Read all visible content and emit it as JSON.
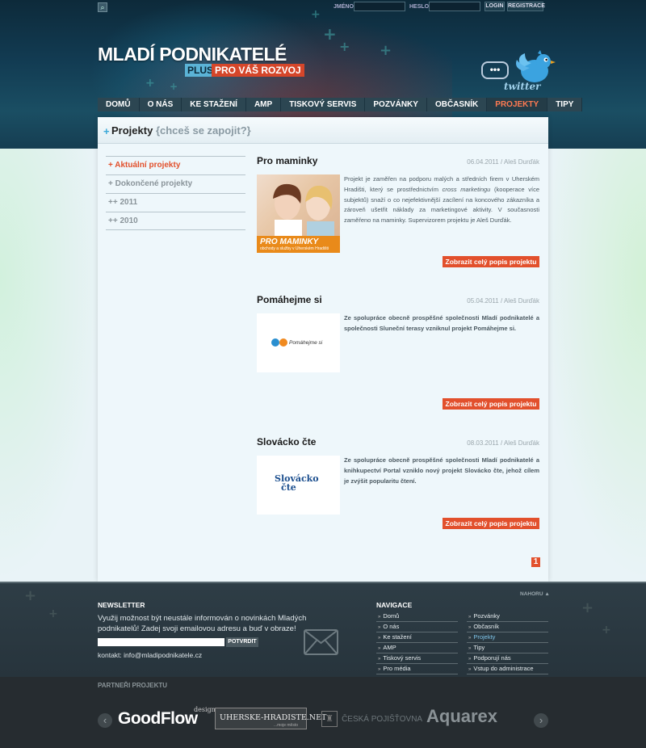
{
  "topbar": {
    "name_label": "JMÉNO",
    "password_label": "HESLO",
    "login_button": "LOGIN",
    "register_button": "REGISTRACE"
  },
  "logo": {
    "title": "MLADÍ PODNIKATELÉ",
    "plus": "PLUS",
    "tagline": "PRO VÁŠ ROZVOJ"
  },
  "twitter": {
    "bubble": "•••",
    "label": "twitter"
  },
  "nav": {
    "items": [
      "DOMŮ",
      "O NÁS",
      "KE STAŽENÍ",
      "AMP",
      "TISKOVÝ SERVIS",
      "POZVÁNKY",
      "OBČASNÍK",
      "PROJEKTY",
      "TIPY"
    ],
    "active": "PROJEKTY"
  },
  "page": {
    "title": "Projekty",
    "subtitle": "{chceš se zapojit?}"
  },
  "sidenav": {
    "items": [
      "+ Aktuální projekty",
      "+ Dokončené projekty",
      "++ 2011",
      "++ 2010"
    ],
    "active_index": 0
  },
  "projects": [
    {
      "title": "Pro maminky",
      "meta": "06.04.2011 / Aleš Durďák",
      "text_before": "Projekt je zaměřen na podporu malých a středních firem v Uherském Hradišti, který se prostřednictvím ",
      "text_italic": "cross marketingu",
      "text_after": " (kooperace více subjektů) snaží o co nejefektivnější zacílení na koncového zákazníka a zároveň ušetřit náklady za marketingové aktivity. V současnosti zaměřeno na maminky. Supervizorem projektu je Aleš Durďák.",
      "image_title": "PRO MAMINKY",
      "image_subtitle": "obchody a služby v Uherském Hradišti",
      "button": "Zobrazit celý popis projektu"
    },
    {
      "title": "Pomáhejme si",
      "meta": "05.04.2011 / Aleš Durďák",
      "text": "Ze spolupráce obecně prospěšné společnosti Mladí podnikatelé a společnosti Sluneční terasy vzniknul projekt Pomáhejme si.",
      "image_logo": "Pomáhejme si",
      "button": "Zobrazit celý popis projektu"
    },
    {
      "title": "Slovácko čte",
      "meta": "08.03.2011 / Aleš Durďák",
      "text": "Ze spolupráce obecně prospěšné společnosti Mladí podnikatelé a knihkupectví Portal vzniklo nový projekt Slovácko čte, jehož cílem je zvýšit popularitu čtení.",
      "image_logo_line1": "Slovácko",
      "image_logo_line2": "čte",
      "button": "Zobrazit celý popis projektu"
    }
  ],
  "pager": {
    "current": "1"
  },
  "footer": {
    "nahoru": "NAHORU",
    "newsletter": {
      "heading": "NEWSLETTER",
      "text": "Využij možnost být neustále informován o novinkách Mladých podnikatelů! Zadej svoji emailovou adresu a buď v obraze!",
      "button": "POTVRDIT",
      "contact": "kontakt: info@mladipodnikatele.cz"
    },
    "navigation": {
      "heading": "NAVIGACE",
      "col1": [
        "Domů",
        "O nás",
        "Ke stažení",
        "AMP",
        "Tiskový servis",
        "Pro média"
      ],
      "col2": [
        "Pozvánky",
        "Občasník",
        "Projekty",
        "Tipy",
        "Podporují nás",
        "Vstup do administrace"
      ],
      "active": "Projekty"
    }
  },
  "partners": {
    "title": "PARTNEŘI PROJEKTU",
    "items": [
      "GoodFlow",
      "design",
      "UHERSKE-HRADISTE.NET",
      "...moje město",
      "ČESKÁ POJIŠŤOVNA",
      "Aquarex"
    ]
  }
}
